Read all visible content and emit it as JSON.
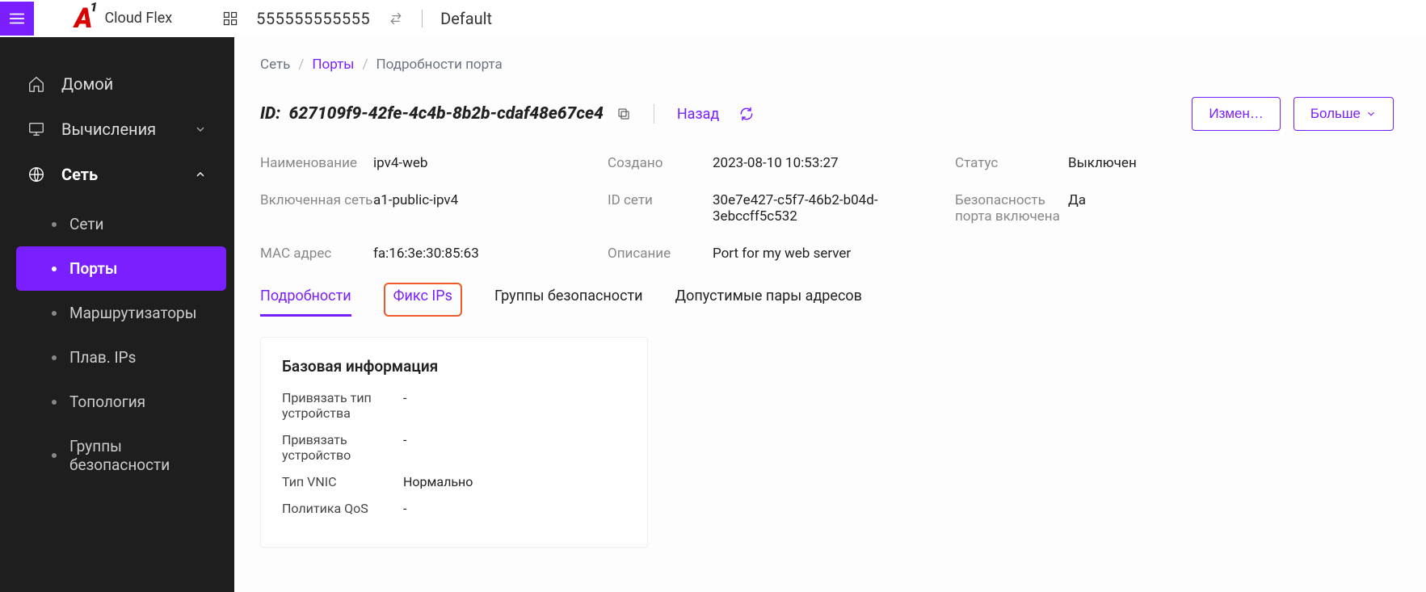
{
  "header": {
    "product": "Cloud Flex",
    "project_number": "555555555555",
    "tenant": "Default"
  },
  "sidebar": {
    "home": "Домой",
    "compute": "Вычисления",
    "network": "Сеть",
    "sub": {
      "networks": "Сети",
      "ports": "Порты",
      "routers": "Маршрутизаторы",
      "floating_ips": "Плав. IPs",
      "topology": "Топология",
      "sec_groups": "Группы безопасности"
    }
  },
  "breadcrumb": {
    "root": "Сеть",
    "lvl1": "Порты",
    "lvl2": "Подробности порта"
  },
  "title": {
    "id_label": "ID:",
    "id_value": "627109f9-42fe-4c4b-8b2b-cdaf48e67ce4",
    "back": "Назад",
    "edit": "Измен…",
    "more": "Больше"
  },
  "info": {
    "name_label": "Наименование",
    "name_value": "ipv4-web",
    "created_label": "Создано",
    "created_value": "2023-08-10 10:53:27",
    "status_label": "Статус",
    "status_value": "Выключен",
    "net_label": "Включенная сеть",
    "net_value": "a1-public-ipv4",
    "netid_label": "ID сети",
    "netid_value": "30e7e427-c5f7-46b2-b04d-3ebccff5c532",
    "portsec_label": "Безопасность порта включена",
    "portsec_value": "Да",
    "mac_label": "MAC адрес",
    "mac_value": "fa:16:3e:30:85:63",
    "desc_label": "Описание",
    "desc_value": "Port for my web server"
  },
  "tabs": {
    "details": "Подробности",
    "fixed_ips": "Фикс IPs",
    "sec_groups": "Группы безопасности",
    "allowed_pairs": "Допустимые пары адресов"
  },
  "card": {
    "title": "Базовая информация",
    "bind_type_label": "Привязать тип устройства",
    "bind_type_value": "-",
    "bind_dev_label": "Привязать устройство",
    "bind_dev_value": "-",
    "vnic_label": "Тип VNIC",
    "vnic_value": "Нормально",
    "qos_label": "Политика QoS",
    "qos_value": "-"
  }
}
